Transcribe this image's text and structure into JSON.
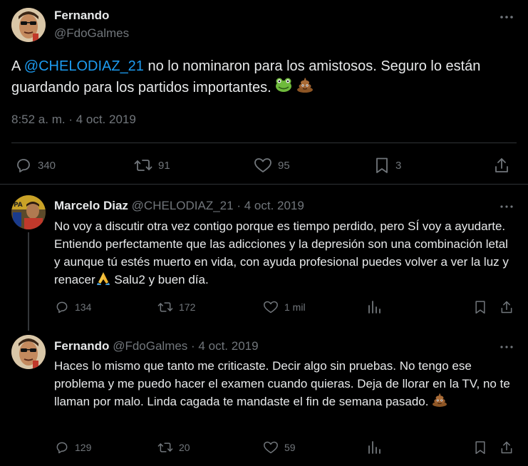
{
  "main_tweet": {
    "author_name": "Fernando",
    "author_handle": "@FdoGalmes",
    "text_before": "A ",
    "mention": "@CHELODIAZ_21",
    "text_after": " no lo nominaron para los amistosos. Seguro lo están guardando para los partidos importantes.",
    "timestamp": "8:52 a. m. · 4 oct. 2019",
    "stats": {
      "replies": "340",
      "retweets": "91",
      "likes": "95",
      "bookmarks": "3"
    }
  },
  "replies": [
    {
      "author_name": "Marcelo Diaz",
      "author_handle": "@CHELODIAZ_21",
      "date": "· 4 oct. 2019",
      "text": "No voy a discutir otra vez contigo porque es tiempo perdido, pero SÍ voy a ayudarte. Entiendo perfectamente que las adicciones y la depresión son una combinación letal y aunque tú estés muerto en vida, con ayuda profesional puedes volver a ver la luz y renacer",
      "text_end": " Salu2 y buen día.",
      "replies": "134",
      "retweets": "172",
      "likes": "1 mil"
    },
    {
      "author_name": "Fernando",
      "author_handle": "@FdoGalmes",
      "date": "· 4 oct. 2019",
      "text": "Haces lo mismo que tanto me criticaste. Decir algo sin pruebas. No tengo ese problema y me puedo hacer el examen cuando quieras. Deja de llorar en la TV, no te llaman por malo. Linda cagada te mandaste el fin de semana pasado.",
      "replies": "129",
      "retweets": "20",
      "likes": "59"
    }
  ],
  "icons": {
    "more": "more-icon",
    "reply": "reply-icon",
    "retweet": "retweet-icon",
    "like": "heart-icon",
    "bookmark": "bookmark-icon",
    "share": "share-icon",
    "views": "views-icon"
  },
  "colors": {
    "background": "#000000",
    "text": "#e7e9ea",
    "muted": "#71767b",
    "mention": "#1d9bf0",
    "divider": "#2f3336"
  }
}
